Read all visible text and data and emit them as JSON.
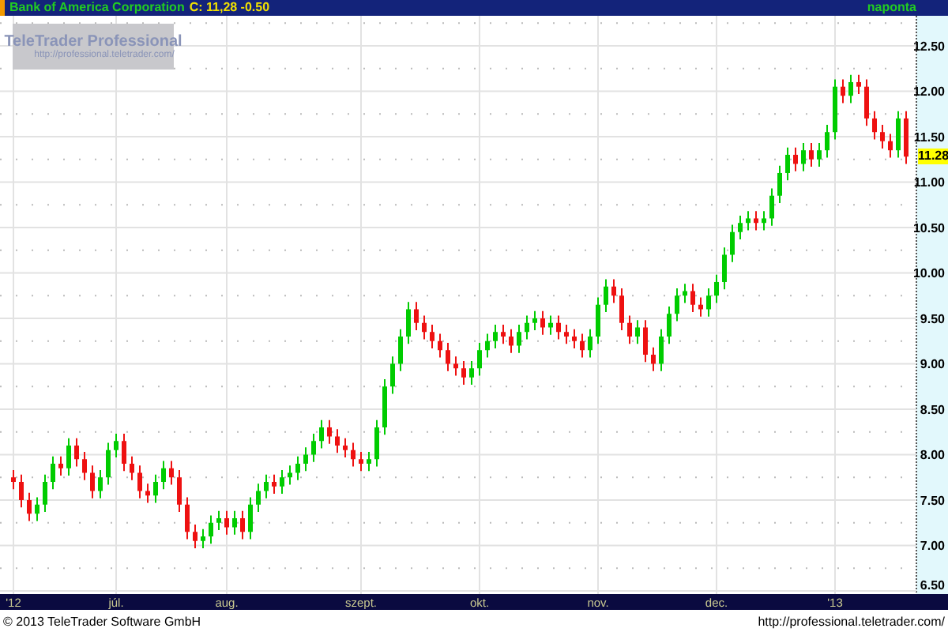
{
  "header": {
    "instrument": "Bank of America Corporation",
    "quote": "C: 11,28 -0.50",
    "interval": "naponta"
  },
  "watermark": {
    "title": "TeleTrader Professional",
    "url": "http://professional.teletrader.com/"
  },
  "chart": {
    "last_price_label": "11.28",
    "chart_data": {
      "type": "candlestick",
      "grid": true,
      "ylim": [
        6.5,
        12.83
      ],
      "yticks": [
        {
          "value": 6.5,
          "label": "6.50"
        },
        {
          "value": 7,
          "label": "7.00"
        },
        {
          "value": 7.5,
          "label": "7.50"
        },
        {
          "value": 8,
          "label": "8.00"
        },
        {
          "value": 8.5,
          "label": "8.50"
        },
        {
          "value": 9,
          "label": "9.00"
        },
        {
          "value": 9.5,
          "label": "9.50"
        },
        {
          "value": 10,
          "label": "10.00"
        },
        {
          "value": 10.5,
          "label": "10.50"
        },
        {
          "value": 11,
          "label": "11.00"
        },
        {
          "value": 11.5,
          "label": "11.50"
        },
        {
          "value": 12,
          "label": "12.00"
        },
        {
          "value": 12.5,
          "label": "12.50"
        }
      ],
      "categories": [
        "'12",
        null,
        null,
        null,
        null,
        null,
        null,
        null,
        null,
        null,
        null,
        null,
        null,
        "júl.",
        null,
        null,
        null,
        null,
        null,
        null,
        null,
        null,
        null,
        null,
        null,
        null,
        null,
        "aug.",
        null,
        null,
        null,
        null,
        null,
        null,
        null,
        null,
        null,
        null,
        null,
        null,
        null,
        null,
        null,
        null,
        "szept.",
        null,
        null,
        null,
        null,
        null,
        null,
        null,
        null,
        null,
        null,
        null,
        null,
        null,
        null,
        "okt.",
        null,
        null,
        null,
        null,
        null,
        null,
        null,
        null,
        null,
        null,
        null,
        null,
        null,
        null,
        "nov.",
        null,
        null,
        null,
        null,
        null,
        null,
        null,
        null,
        null,
        null,
        null,
        null,
        null,
        null,
        "dec.",
        null,
        null,
        null,
        null,
        null,
        null,
        null,
        null,
        null,
        null,
        null,
        null,
        null,
        null,
        "'13",
        null,
        null,
        null,
        null,
        null,
        null,
        null,
        null,
        null
      ],
      "ohlc": [
        [
          7.75,
          7.83,
          7.62,
          7.7
        ],
        [
          7.7,
          7.78,
          7.42,
          7.5
        ],
        [
          7.5,
          7.58,
          7.27,
          7.35
        ],
        [
          7.35,
          7.53,
          7.27,
          7.45
        ],
        [
          7.45,
          7.78,
          7.37,
          7.7
        ],
        [
          7.7,
          7.98,
          7.62,
          7.9
        ],
        [
          7.9,
          7.98,
          7.77,
          7.85
        ],
        [
          7.85,
          8.18,
          7.77,
          8.1
        ],
        [
          8.1,
          8.18,
          7.87,
          7.95
        ],
        [
          7.95,
          8.03,
          7.72,
          7.8
        ],
        [
          7.8,
          7.88,
          7.52,
          7.6
        ],
        [
          7.6,
          7.83,
          7.52,
          7.75
        ],
        [
          7.75,
          8.13,
          7.67,
          8.05
        ],
        [
          8.05,
          8.23,
          7.97,
          8.15
        ],
        [
          8.15,
          8.23,
          7.82,
          7.9
        ],
        [
          7.9,
          7.98,
          7.72,
          7.8
        ],
        [
          7.8,
          7.88,
          7.52,
          7.6
        ],
        [
          7.6,
          7.68,
          7.47,
          7.55
        ],
        [
          7.55,
          7.78,
          7.47,
          7.7
        ],
        [
          7.7,
          7.93,
          7.62,
          7.85
        ],
        [
          7.85,
          7.93,
          7.67,
          7.75
        ],
        [
          7.75,
          7.83,
          7.37,
          7.45
        ],
        [
          7.45,
          7.53,
          7.07,
          7.15
        ],
        [
          7.15,
          7.23,
          6.97,
          7.05
        ],
        [
          7.05,
          7.18,
          6.97,
          7.1
        ],
        [
          7.1,
          7.33,
          7.02,
          7.25
        ],
        [
          7.25,
          7.38,
          7.17,
          7.3
        ],
        [
          7.3,
          7.38,
          7.12,
          7.2
        ],
        [
          7.2,
          7.38,
          7.12,
          7.3
        ],
        [
          7.3,
          7.38,
          7.07,
          7.15
        ],
        [
          7.15,
          7.53,
          7.07,
          7.45
        ],
        [
          7.45,
          7.68,
          7.37,
          7.6
        ],
        [
          7.6,
          7.78,
          7.52,
          7.7
        ],
        [
          7.7,
          7.78,
          7.57,
          7.65
        ],
        [
          7.65,
          7.83,
          7.57,
          7.75
        ],
        [
          7.75,
          7.88,
          7.67,
          7.8
        ],
        [
          7.8,
          7.98,
          7.72,
          7.9
        ],
        [
          7.9,
          8.08,
          7.82,
          8.0
        ],
        [
          8.0,
          8.23,
          7.92,
          8.15
        ],
        [
          8.15,
          8.38,
          8.07,
          8.3
        ],
        [
          8.3,
          8.38,
          8.12,
          8.2
        ],
        [
          8.2,
          8.28,
          8.02,
          8.1
        ],
        [
          8.1,
          8.18,
          7.97,
          8.05
        ],
        [
          8.05,
          8.13,
          7.87,
          7.95
        ],
        [
          7.95,
          8.03,
          7.82,
          7.9
        ],
        [
          7.9,
          8.03,
          7.82,
          7.95
        ],
        [
          7.95,
          8.38,
          7.87,
          8.3
        ],
        [
          8.3,
          8.83,
          8.22,
          8.75
        ],
        [
          8.75,
          9.08,
          8.67,
          9.0
        ],
        [
          9.0,
          9.38,
          8.92,
          9.3
        ],
        [
          9.3,
          9.68,
          9.22,
          9.6
        ],
        [
          9.6,
          9.68,
          9.37,
          9.45
        ],
        [
          9.45,
          9.53,
          9.27,
          9.35
        ],
        [
          9.35,
          9.43,
          9.17,
          9.25
        ],
        [
          9.25,
          9.33,
          9.07,
          9.15
        ],
        [
          9.15,
          9.23,
          8.92,
          9.0
        ],
        [
          9.0,
          9.08,
          8.87,
          8.95
        ],
        [
          8.95,
          9.03,
          8.77,
          8.85
        ],
        [
          8.85,
          9.03,
          8.77,
          8.95
        ],
        [
          8.95,
          9.23,
          8.87,
          9.15
        ],
        [
          9.15,
          9.33,
          9.07,
          9.25
        ],
        [
          9.25,
          9.43,
          9.17,
          9.35
        ],
        [
          9.35,
          9.43,
          9.22,
          9.3
        ],
        [
          9.3,
          9.38,
          9.12,
          9.2
        ],
        [
          9.2,
          9.43,
          9.12,
          9.35
        ],
        [
          9.35,
          9.53,
          9.27,
          9.45
        ],
        [
          9.45,
          9.58,
          9.37,
          9.5
        ],
        [
          9.5,
          9.58,
          9.32,
          9.4
        ],
        [
          9.4,
          9.53,
          9.32,
          9.45
        ],
        [
          9.45,
          9.53,
          9.27,
          9.35
        ],
        [
          9.35,
          9.43,
          9.22,
          9.3
        ],
        [
          9.3,
          9.38,
          9.17,
          9.25
        ],
        [
          9.25,
          9.33,
          9.07,
          9.15
        ],
        [
          9.15,
          9.38,
          9.07,
          9.3
        ],
        [
          9.3,
          9.73,
          9.22,
          9.65
        ],
        [
          9.65,
          9.93,
          9.57,
          9.85
        ],
        [
          9.85,
          9.93,
          9.67,
          9.75
        ],
        [
          9.75,
          9.83,
          9.37,
          9.45
        ],
        [
          9.45,
          9.53,
          9.22,
          9.3
        ],
        [
          9.3,
          9.48,
          9.22,
          9.4
        ],
        [
          9.4,
          9.48,
          9.02,
          9.1
        ],
        [
          9.1,
          9.18,
          8.92,
          9.0
        ],
        [
          9.0,
          9.38,
          8.92,
          9.3
        ],
        [
          9.3,
          9.63,
          9.22,
          9.55
        ],
        [
          9.55,
          9.83,
          9.47,
          9.75
        ],
        [
          9.75,
          9.88,
          9.67,
          9.8
        ],
        [
          9.8,
          9.88,
          9.57,
          9.65
        ],
        [
          9.65,
          9.73,
          9.52,
          9.6
        ],
        [
          9.6,
          9.83,
          9.52,
          9.75
        ],
        [
          9.75,
          9.98,
          9.67,
          9.9
        ],
        [
          9.9,
          10.28,
          9.82,
          10.2
        ],
        [
          10.2,
          10.53,
          10.12,
          10.45
        ],
        [
          10.45,
          10.63,
          10.37,
          10.55
        ],
        [
          10.55,
          10.68,
          10.47,
          10.6
        ],
        [
          10.6,
          10.68,
          10.47,
          10.55
        ],
        [
          10.55,
          10.68,
          10.47,
          10.6
        ],
        [
          10.6,
          10.93,
          10.52,
          10.85
        ],
        [
          10.85,
          11.18,
          10.77,
          11.1
        ],
        [
          11.1,
          11.38,
          11.02,
          11.3
        ],
        [
          11.3,
          11.38,
          11.12,
          11.2
        ],
        [
          11.2,
          11.43,
          11.12,
          11.35
        ],
        [
          11.35,
          11.43,
          11.17,
          11.25
        ],
        [
          11.25,
          11.43,
          11.17,
          11.35
        ],
        [
          11.35,
          11.63,
          11.27,
          11.55
        ],
        [
          11.55,
          12.13,
          11.47,
          12.05
        ],
        [
          12.05,
          12.13,
          11.87,
          11.95
        ],
        [
          11.95,
          12.18,
          11.87,
          12.1
        ],
        [
          12.1,
          12.18,
          11.97,
          12.05
        ],
        [
          12.05,
          12.13,
          11.62,
          11.7
        ],
        [
          11.7,
          11.78,
          11.47,
          11.55
        ],
        [
          11.55,
          11.63,
          11.37,
          11.45
        ],
        [
          11.45,
          11.53,
          11.27,
          11.35
        ],
        [
          11.35,
          11.78,
          11.27,
          11.7
        ],
        [
          11.7,
          11.78,
          11.2,
          11.28
        ]
      ]
    }
  },
  "footer": {
    "copyright": "© 2013 TeleTrader Software GmbH",
    "url": "http://professional.teletrader.com/"
  }
}
